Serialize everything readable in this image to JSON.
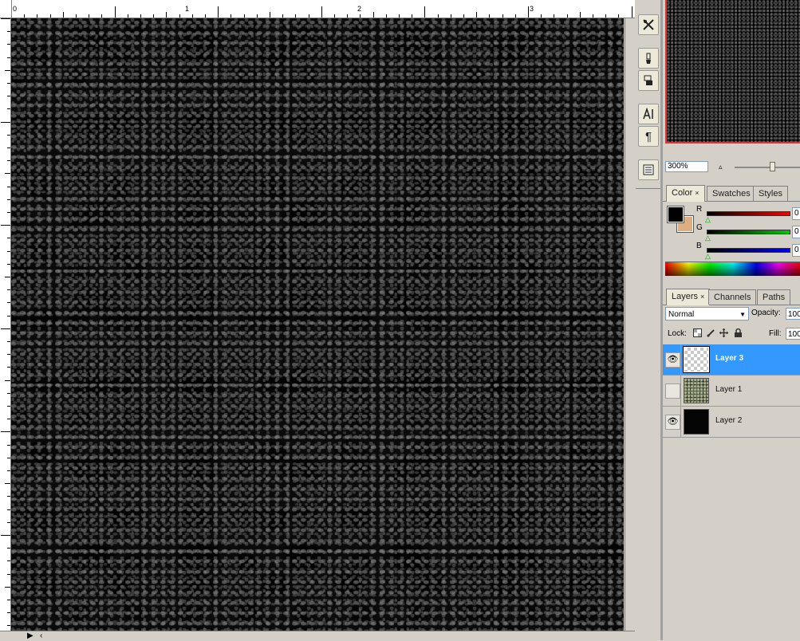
{
  "ruler": {
    "labels": [
      "0",
      "1",
      "2",
      "3"
    ]
  },
  "toolstrip": {
    "icons": [
      "tool-presets-icon",
      "brushes-icon",
      "clone-source-icon",
      "character-icon",
      "paragraph-icon",
      "layer-comps-icon"
    ]
  },
  "navigator": {
    "zoom": "300%"
  },
  "color_panel": {
    "tabs": [
      "Color",
      "Swatches",
      "Styles"
    ],
    "close_glyph": "×",
    "foreground": "#000000",
    "background": "#dcae82",
    "channels": [
      {
        "label": "R",
        "value": "0"
      },
      {
        "label": "G",
        "value": "0"
      },
      {
        "label": "B",
        "value": "0"
      }
    ]
  },
  "layers_panel": {
    "tabs": [
      "Layers",
      "Channels",
      "Paths"
    ],
    "close_glyph": "×",
    "blend_mode": "Normal",
    "opacity_label": "Opacity:",
    "opacity_value": "100",
    "lock_label": "Lock:",
    "fill_label": "Fill:",
    "fill_value": "100",
    "layers": [
      {
        "name": "Layer 3",
        "visible": true,
        "selected": true
      },
      {
        "name": "Layer 1",
        "visible": false,
        "selected": false
      },
      {
        "name": "Layer 2",
        "visible": true,
        "selected": false
      }
    ]
  },
  "colors": {
    "selection": "#3399ff",
    "navigator_frame": "#dd3333",
    "panel_bg": "#d4d0c8"
  }
}
